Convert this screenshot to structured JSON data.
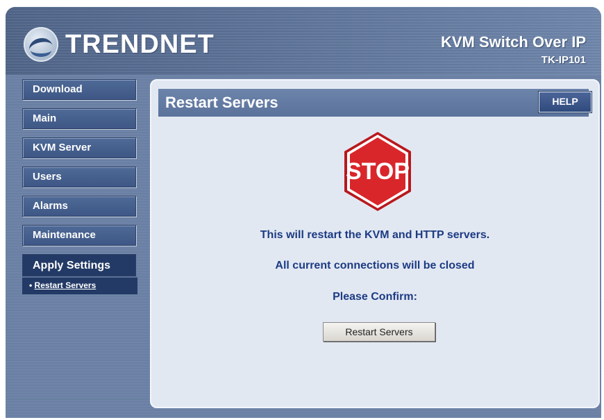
{
  "brand": {
    "logo_text": "TRENDNET"
  },
  "header": {
    "product_title": "KVM Switch Over IP",
    "model": "TK-IP101"
  },
  "sidebar": {
    "items": [
      {
        "label": "Download"
      },
      {
        "label": "Main"
      },
      {
        "label": "KVM Server"
      },
      {
        "label": "Users"
      },
      {
        "label": "Alarms"
      },
      {
        "label": "Maintenance"
      },
      {
        "label": "Apply Settings"
      }
    ],
    "sub_items": [
      {
        "label": "Restart Servers"
      }
    ]
  },
  "panel": {
    "title": "Restart Servers",
    "help_label": "HELP",
    "stop_text": "STOP",
    "message1": "This will restart the KVM and HTTP servers.",
    "message2": "All current connections will be closed",
    "confirm_text": "Please Confirm:",
    "restart_button_label": "Restart Servers"
  },
  "colors": {
    "stop_red": "#d9262b",
    "text_blue": "#1d3b83",
    "nav_blue": "#3e5786",
    "active_nav": "#223a65"
  }
}
